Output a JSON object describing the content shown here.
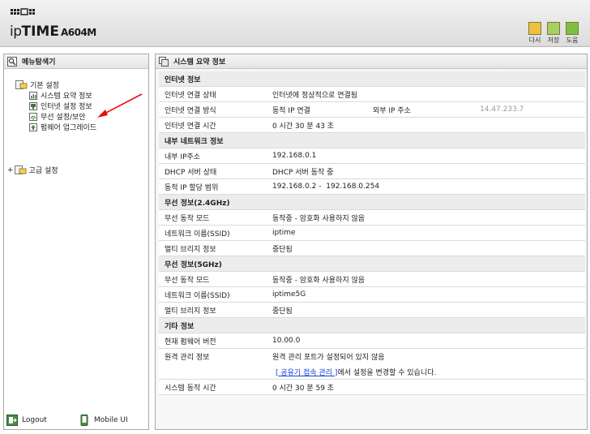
{
  "header": {
    "brand": {
      "prefix": "ip",
      "bold": "TIME",
      "model": "A604M"
    },
    "toolbar": [
      {
        "label": "다시",
        "icon": "refresh-icon",
        "color": "#f0c040"
      },
      {
        "label": "저장",
        "icon": "save-icon",
        "color": "#a8d060"
      },
      {
        "label": "도움",
        "icon": "help-icon",
        "color": "#80c040"
      }
    ]
  },
  "sidebar": {
    "title": "메뉴탐색기",
    "basic_label": "기본 설정",
    "items": [
      "시스템 요약 정보",
      "인터넷 설정 정보",
      "무선 설정/보안",
      "펌웨어 업그레이드"
    ],
    "advanced_label": "고급 설정",
    "logout": "Logout",
    "mobile_ui": "Mobile UI"
  },
  "main": {
    "title": "시스템 요약 정보",
    "sections": {
      "internet": {
        "title": "인터넷 정보",
        "status_label": "인터넷 연결 상태",
        "status_value": "인터넷에 정상적으로 연결됨",
        "method_label": "인터넷 연결 방식",
        "method_value": "동적 IP 연결",
        "external_ip_label": "외부 IP 주소",
        "external_ip_value": "14.47.233.7",
        "time_label": "인터넷 연결 시간",
        "time_value": "0 시간 30 분 43 초"
      },
      "lan": {
        "title": "내부 네트워크 정보",
        "ip_label": "내부 IP주소",
        "ip_value": "192.168.0.1",
        "dhcp_label": "DHCP 서버 상태",
        "dhcp_value": "DHCP 서버 동작 중",
        "range_label": "동적 IP 할당 범위",
        "range_value": "192.168.0.2 -  192.168.0.254"
      },
      "wifi24": {
        "title": "무선 정보(2.4GHz)",
        "mode_label": "무선 동작 모드",
        "mode_value": "동작중 - 암호화 사용하지 않음",
        "ssid_label": "네트워크 이름(SSID)",
        "ssid_value": "iptime",
        "bridge_label": "멀티 브리지 정보",
        "bridge_value": "중단됨"
      },
      "wifi5": {
        "title": "무선 정보(5GHz)",
        "mode_label": "무선 동작 모드",
        "mode_value": "동작중 - 암호화 사용하지 않음",
        "ssid_label": "네트워크 이름(SSID)",
        "ssid_value": "iptime5G",
        "bridge_label": "멀티 브리지 정보",
        "bridge_value": "중단됨"
      },
      "other": {
        "title": "기타 정보",
        "fw_label": "현재 펌웨어 버전",
        "fw_value": "10.00.0",
        "remote_label": "원격 관리 정보",
        "remote_value": "원격 관리 포트가 설정되어 있지 않음",
        "remote_link": "[ 공유기 접속 관리 ]",
        "remote_link_suffix": "에서 설정을 변경할 수 있습니다.",
        "uptime_label": "시스템 동작 시간",
        "uptime_value": "0 시간 30 분 59 초"
      }
    }
  },
  "colors": {
    "link": "#1a3fd8",
    "arrow": "#e01010",
    "section_bg": "#ececec"
  }
}
